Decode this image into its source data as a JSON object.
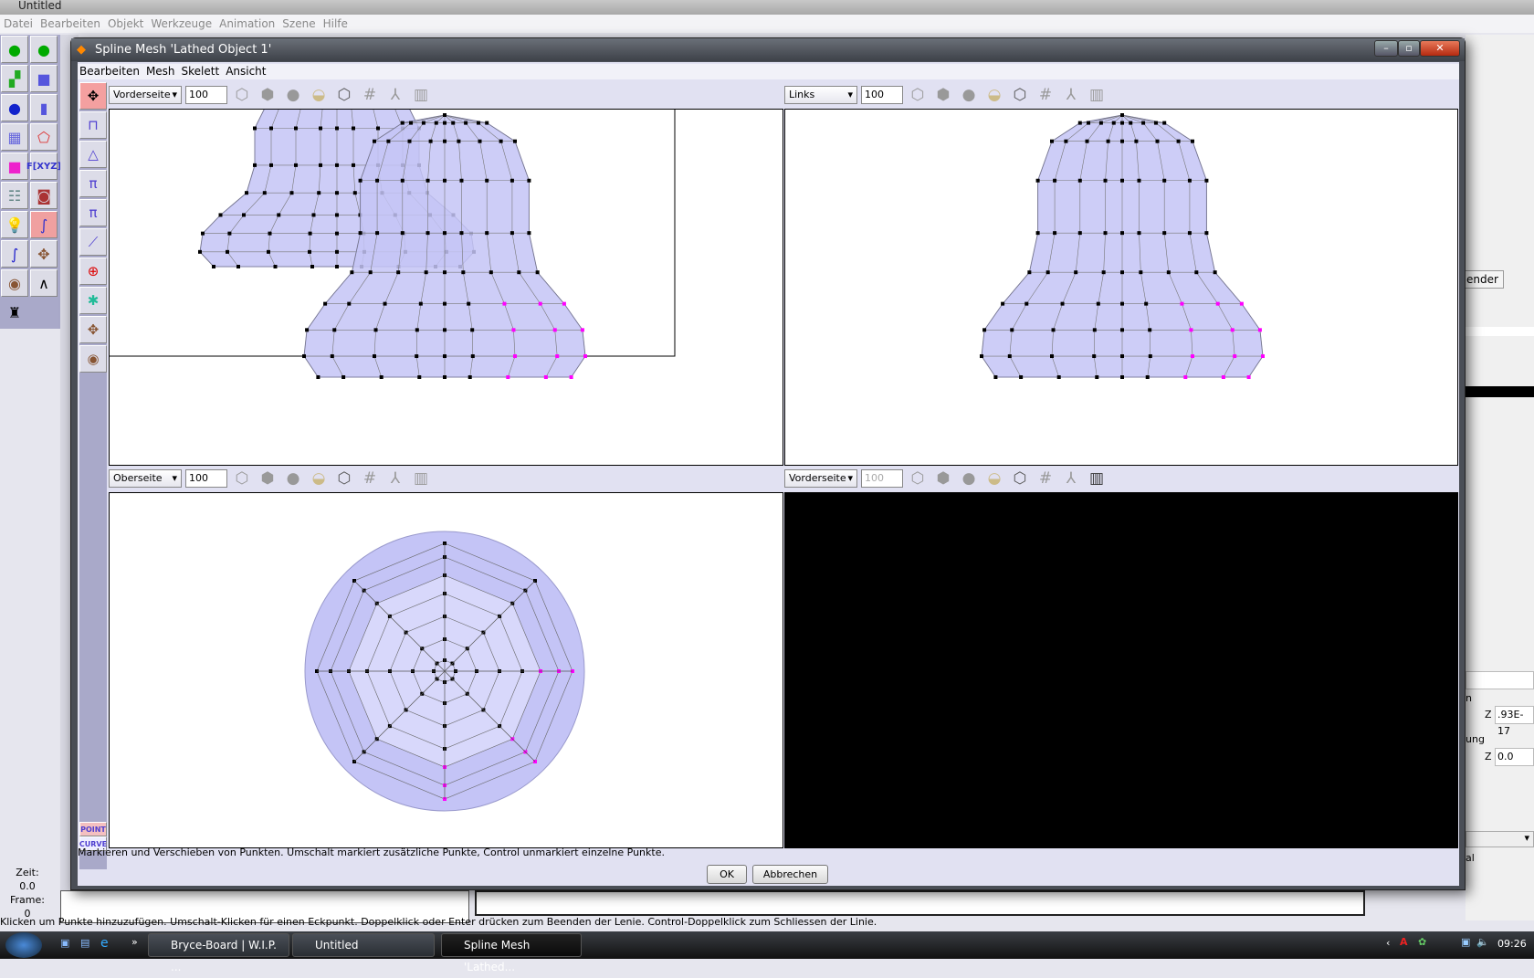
{
  "app": {
    "title": "Untitled",
    "menu": [
      "Datei",
      "Bearbeiten",
      "Objekt",
      "Werkzeuge",
      "Animation",
      "Szene",
      "Hilfe"
    ],
    "time_label": "Zeit:",
    "time_value": "0.0",
    "frame_label": "Frame:",
    "frame_value": "0",
    "status": "Klicken um Punkte hinzuzufügen. Umschalt-Klicken für einen Eckpunkt. Doppelklick oder Enter drücken zum Beenden der Lenie. Control-Doppelklick zum Schliessen der Linie.",
    "right_panel": {
      "render_button": "ender",
      "label_n": "n",
      "z_label": "Z",
      "z1_value": ".93E-17",
      "label_ung": "ung",
      "z2_value": "0.0",
      "label_al": "al"
    }
  },
  "dialog": {
    "title": "Spline Mesh 'Lathed Object 1'",
    "menu": [
      "Bearbeiten",
      "Mesh",
      "Skelett",
      "Ansicht"
    ],
    "viewports": [
      {
        "view": "Vorderseite",
        "zoom": "100"
      },
      {
        "view": "Links",
        "zoom": "100"
      },
      {
        "view": "Oberseite",
        "zoom": "100"
      },
      {
        "view": "Vorderseite",
        "zoom": "100"
      }
    ],
    "mode_point": "POINT",
    "mode_curve": "CURVE",
    "status": "Markieren und Verschieben von Punkten. Umschalt markiert zusätzliche Punkte, Control unmarkiert einzelne Punkte.",
    "ok": "OK",
    "cancel": "Abbrechen"
  },
  "taskbar": {
    "items": [
      "Bryce-Board | W.I.P. ...",
      "Untitled",
      "Spline Mesh 'Lathed..."
    ],
    "clock": "09:26"
  },
  "colors": {
    "mesh_fill": "#c4c4f6",
    "point": "#000000",
    "selected_point": "#ff00ff"
  }
}
